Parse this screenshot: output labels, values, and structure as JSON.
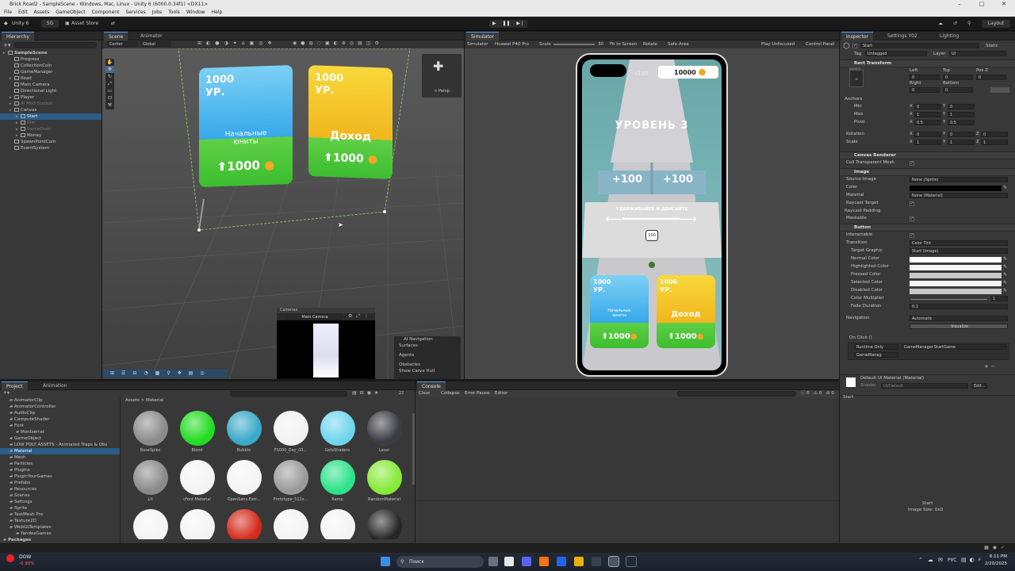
{
  "window_title": "Brick Road2 - SampleScene - Windows, Mac, Linux - Unity 6 (6000.0.34f1) <DX11>",
  "menu": [
    "File",
    "Edit",
    "Assets",
    "GameObject",
    "Component",
    "Services",
    "Jobs",
    "Tools",
    "Window",
    "Help"
  ],
  "toolbar": {
    "unity": "Unity 6",
    "account": "SG",
    "asset_store": "Asset Store",
    "layout": "Layout"
  },
  "hierarchy": {
    "tab": "Hierarchy",
    "items": [
      {
        "label": "SampleScene",
        "dim": false
      },
      {
        "label": "Progress",
        "dim": false
      },
      {
        "label": "CollectionCoin",
        "dim": false
      },
      {
        "label": "GameManager",
        "dim": false
      },
      {
        "label": "Road",
        "dim": false
      },
      {
        "label": "Main Camera",
        "dim": false
      },
      {
        "label": "Directional Light",
        "dim": false
      },
      {
        "label": "Player",
        "dim": false
      },
      {
        "label": "AI Mod Station",
        "dim": true
      },
      {
        "label": "Canvas",
        "dim": false
      },
      {
        "label": "Start",
        "dim": false
      },
      {
        "label": "Win",
        "dim": true
      },
      {
        "label": "GameOver",
        "dim": true
      },
      {
        "label": "Money",
        "dim": false
      },
      {
        "label": "SpawnPointCoin",
        "dim": false
      },
      {
        "label": "EventSystem",
        "dim": false
      }
    ]
  },
  "scene": {
    "tabs": [
      "Scene",
      "Animator"
    ],
    "pivot": "Center",
    "space": "Global",
    "persp": "< Persp",
    "cameras_title": "Cameras",
    "camera_select": "Main Camera",
    "overlay": {
      "title": "AI Navigation",
      "items": [
        "Surfaces",
        "Agents",
        "Obstacles",
        "Show Carve Hull"
      ]
    }
  },
  "game_ui": {
    "card1_top": "1000\nУР.",
    "card1_label": "Начальные\nюниты",
    "card1_price": "1000",
    "card2_top": "1000\nУР.",
    "card2_label": "Доход",
    "card2_price": "1000"
  },
  "simulator": {
    "tab": "Simulator",
    "mode": "Simulator",
    "device": "Huawei P40 Pro",
    "scale_label": "Scale",
    "scale_value": "30",
    "fit": "Fit to Screen",
    "rotate": "Rotate",
    "safe": "Safe Area",
    "play_unfocused": "Play Unfocused",
    "control": "Control Panel",
    "coins": "10000",
    "level": "УРОВЕНЬ 3",
    "gate_left": "+100",
    "gate_right": "+100",
    "gate_top": "+100",
    "hint": "УДЕРЖИВАЙТЕ И ДВИГАЙТЕ",
    "player_hp": "100"
  },
  "inspector": {
    "tabs": [
      "Inspector",
      "Settings Y02",
      "Lighting"
    ],
    "name": "Start",
    "static": "Static",
    "tag": "Untagged",
    "layer": "UI",
    "rect_transform": "Rect Transform",
    "stretch": "stretch",
    "left_lbl": "Left",
    "top_lbl": "Top",
    "posz_lbl": "Pos Z",
    "left": "0",
    "top": "0",
    "posz": "0",
    "right_lbl": "Right",
    "bottom_lbl": "Bottom",
    "right": "0",
    "bottom": "0",
    "anchors": "Anchors",
    "min": "Min",
    "max": "Max",
    "pivot": "Pivot",
    "min_x": "0",
    "min_y": "0",
    "max_x": "1",
    "max_y": "1",
    "pivot_x": "0.5",
    "pivot_y": "0.5",
    "rotation": "Rotation",
    "scale": "Scale",
    "rot": [
      "0",
      "0",
      "0"
    ],
    "scl": [
      "1",
      "1",
      "1"
    ],
    "canvas_renderer": "Canvas Renderer",
    "cull": "Cull Transparent Mesh",
    "image": "Image",
    "source_image": "Source Image",
    "source_image_val": "None (Sprite)",
    "color": "Color",
    "material": "Material",
    "material_val": "None (Material)",
    "raycast_target": "Raycast Target",
    "raycast_padding": "Raycast Padding",
    "maskable": "Maskable",
    "button": "Button",
    "interactable": "Interactable",
    "transition": "Transition",
    "transition_val": "Color Tint",
    "target_graphic": "Target Graphic",
    "target_graphic_val": "Start (Image)",
    "normal": "Normal Color",
    "highlighted": "Highlighted Color",
    "pressed": "Pressed Color",
    "selected": "Selected Color",
    "disabled": "Disabled Color",
    "multiplier": "Color Multiplier",
    "multiplier_val": "1",
    "fade": "Fade Duration",
    "fade_val": "0.1",
    "navigation": "Navigation",
    "navigation_val": "Automatic",
    "visualize": "Visualize",
    "onclick": "On Click ()",
    "runtime": "Runtime Only",
    "function": "GameManager.StartGame",
    "object": "GameManag",
    "mat_name": "Default UI Material (Material)",
    "shader_lbl": "Shader",
    "shader": "UI/Default",
    "edit": "Edit...",
    "preview_name": "Start",
    "preview_size": "Image Size: 0x0"
  },
  "project": {
    "tabs": [
      "Project",
      "Animation"
    ],
    "folders": [
      "AnimatorClip",
      "AnimatorController",
      "AudioClip",
      "ComputeShader",
      "Font",
      "Montserrat",
      "GameObject",
      "LOW POLY ASSETS - Animated Traps & Obs",
      "Material",
      "Mesh",
      "Particles",
      "Plugins",
      "PluginYourGames",
      "Prefabs",
      "Resources",
      "Scenes",
      "Settings",
      "Sprite",
      "TextMesh Pro",
      "Texture2D",
      "WebGLTemplates",
      "YandexGames",
      "Packages"
    ],
    "breadcrumb": [
      "Assets",
      "Material"
    ],
    "materials": [
      {
        "name": "BaseSpike",
        "color": "#8a8a8a"
      },
      {
        "name": "Blood",
        "color": "#22dd22"
      },
      {
        "name": "Bubble",
        "color": "#3aaac8"
      },
      {
        "name": "FS000_Day_03...",
        "color": "#f2f2f2"
      },
      {
        "name": "GetsShaders",
        "color": "#6fd6ee"
      },
      {
        "name": "Laser",
        "color": "#3a3d44"
      },
      {
        "name": "Lit",
        "color": "#8a8a8a"
      },
      {
        "name": "cfont Material",
        "color": "#f4f4f4"
      },
      {
        "name": "OpenSans-Extr...",
        "color": "#f4f4f4"
      },
      {
        "name": "Prototype_512x...",
        "color": "#9a9a9a"
      },
      {
        "name": "Ramp",
        "color": "#2ee28a"
      },
      {
        "name": "RandomMaterial",
        "color": "#86ea3a"
      },
      {
        "name": "",
        "color": "#f4f4f4"
      },
      {
        "name": "",
        "color": "#f4f4f4"
      },
      {
        "name": "",
        "color": "#d42a1a"
      },
      {
        "name": "",
        "color": "#f4f4f4"
      },
      {
        "name": "",
        "color": "#f4f4f4"
      },
      {
        "name": "",
        "color": "#262626"
      }
    ],
    "count": "22"
  },
  "console": {
    "tab": "Console",
    "clear": "Clear",
    "collapse": "Collapse",
    "error_pause": "Error Pause",
    "editor": "Editor",
    "c0": "0",
    "c1": "0",
    "c2": "0"
  },
  "taskbar": {
    "stock_name": "DOW",
    "stock_change": "-0.90%",
    "search": "Поиск",
    "lang": "РУС",
    "time": "6:11 PM",
    "date": "2/20/2025"
  }
}
